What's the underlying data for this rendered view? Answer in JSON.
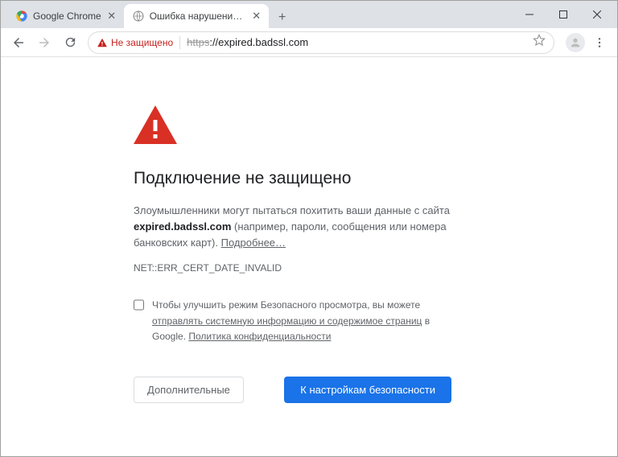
{
  "tabs": [
    {
      "title": "Google Chrome"
    },
    {
      "title": "Ошибка нарушения конфиден..."
    }
  ],
  "toolbar": {
    "security_label": "Не защищено",
    "url_scheme": "https",
    "url_rest": "://expired.badssl.com"
  },
  "page": {
    "heading": "Подключение не защищено",
    "body_pre": "Злоумышленники могут пытаться похитить ваши данные с сайта ",
    "body_host": "expired.badssl.com",
    "body_post": " (например, пароли, сообщения или номера банковских карт). ",
    "body_more": "Подробнее…",
    "error_code": "NET::ERR_CERT_DATE_INVALID",
    "optin_pre": "Чтобы улучшить режим Безопасного просмотра, вы можете ",
    "optin_link1": "отправлять системную информацию и содержимое страниц",
    "optin_mid": " в Google. ",
    "optin_link2": "Политика конфиденциальности",
    "advanced_label": "Дополнительные",
    "proceed_label": "К настройкам безопасности"
  }
}
